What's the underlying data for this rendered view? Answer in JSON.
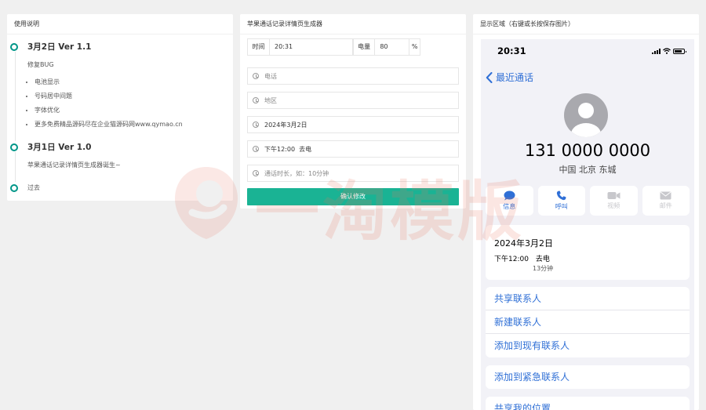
{
  "instructions": {
    "heading": "使用说明",
    "versions": [
      {
        "title": "3月2日 Ver 1.1",
        "desc": "修复BUG",
        "items": [
          "电池显示",
          "号码居中间题",
          "字体优化",
          "更多免费精品源码尽在企业猫源码网www.qymao.cn"
        ]
      },
      {
        "title": "3月1日 Ver 1.0",
        "desc": "苹果通话记录详情页生成器诞生~"
      }
    ],
    "past": "过去"
  },
  "generator": {
    "heading": "苹果通话记录详情页生成器",
    "time_label": "时间",
    "time_value": "20:31",
    "battery_label": "电量",
    "battery_value": "80",
    "battery_unit": "%",
    "phone_placeholder": "电话",
    "area_placeholder": "地区",
    "date_value": "2024年3月2日",
    "call_value": "下午12:00  去电",
    "duration_placeholder": "通话时长，如：10分钟",
    "confirm_label": "确认修改"
  },
  "display": {
    "heading": "显示区域（右键或长按保存图片）",
    "status_time": "20:31",
    "battery_level": 0.8,
    "back_label": "最近通话",
    "number": "131 0000 0000",
    "location": "中国 北京 东城",
    "actions": [
      {
        "label": "信息",
        "icon": "message-icon",
        "enabled": true
      },
      {
        "label": "呼叫",
        "icon": "phone-icon",
        "enabled": true
      },
      {
        "label": "视频",
        "icon": "video-icon",
        "enabled": false
      },
      {
        "label": "邮件",
        "icon": "mail-icon",
        "enabled": false
      }
    ],
    "call_date": "2024年3月2日",
    "call_time": "下午12:00",
    "call_type": "去电",
    "call_duration": "13分钟",
    "links_group1": [
      "共享联系人",
      "新建联系人",
      "添加到现有联系人"
    ],
    "link_emergency": "添加到紧急联系人",
    "link_location": "共享我的位置"
  },
  "watermark": {
    "text": "一淘模版"
  },
  "colors": {
    "accent": "#1ab394",
    "ios_blue": "#2f6fd6",
    "timeline": "#009688"
  }
}
